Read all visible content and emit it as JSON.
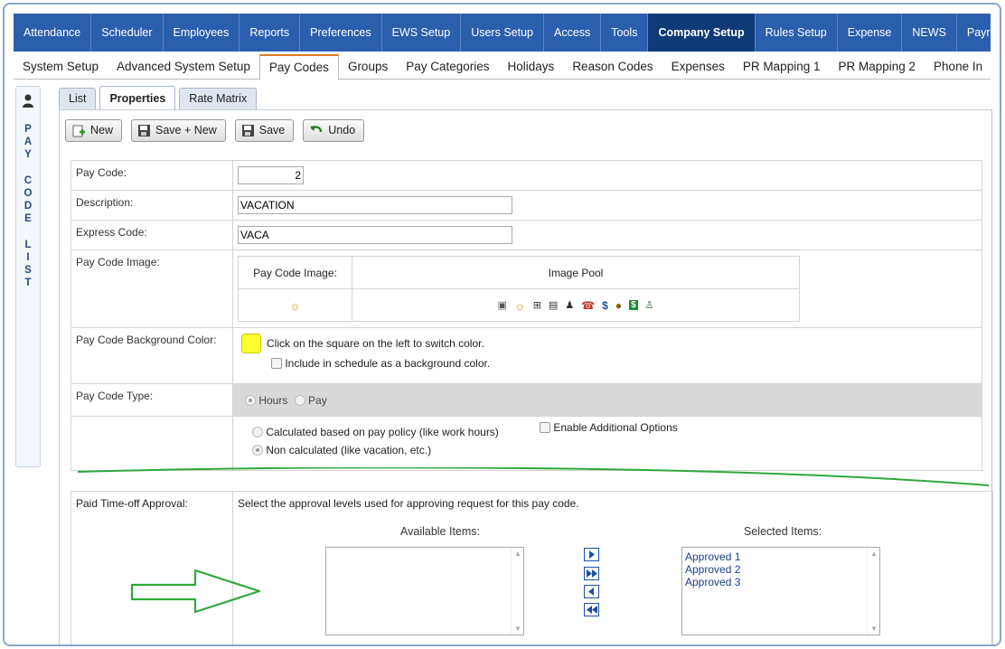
{
  "topnav": {
    "items": [
      "Attendance",
      "Scheduler",
      "Employees",
      "Reports",
      "Preferences",
      "EWS Setup",
      "Users Setup",
      "Access",
      "Tools",
      "Company Setup",
      "Rules Setup",
      "Expense",
      "NEWS",
      "Payroll"
    ],
    "active": "Company Setup"
  },
  "subnav": {
    "items": [
      "System Setup",
      "Advanced System Setup",
      "Pay Codes",
      "Groups",
      "Pay Categories",
      "Holidays",
      "Reason Codes",
      "Expenses",
      "PR Mapping 1",
      "PR Mapping 2",
      "Phone In"
    ],
    "active": "Pay Codes"
  },
  "side_panel": {
    "label": "PAY CODE LIST"
  },
  "tabs": [
    "List",
    "Properties",
    "Rate Matrix"
  ],
  "toolbar": {
    "new": "New",
    "save_new": "Save + New",
    "save": "Save",
    "undo": "Undo"
  },
  "form": {
    "pay_code": {
      "label": "Pay Code:",
      "value": "2"
    },
    "description": {
      "label": "Description:",
      "value": "VACATION"
    },
    "express_code": {
      "label": "Express Code:",
      "value": "VACA"
    },
    "pay_code_image": {
      "label": "Pay Code Image:",
      "col1_header": "Pay Code Image:",
      "col2_header": "Image Pool",
      "selected_icon": "sun-icon",
      "pool_icons": [
        "calendar-icon",
        "sun-icon",
        "medical-kit-icon",
        "calendar-one-icon",
        "person-icon",
        "phone-icon",
        "dollar-icon",
        "burger-icon",
        "money-icon",
        "user-icon"
      ]
    },
    "background_color": {
      "label": "Pay Code Background Color:",
      "color": "#ffff33",
      "hint": "Click on the square on the left to switch color.",
      "include_label": "Include in schedule as a background color."
    },
    "pay_code_type": {
      "label": "Pay Code Type:",
      "hours": "Hours",
      "pay": "Pay",
      "selected": "Hours"
    },
    "calc": {
      "calculated": "Calculated based on pay policy (like work hours)",
      "non_calculated": "Non calculated (like vacation, etc.)",
      "enable_additional": "Enable Additional Options",
      "selected": "non_calculated"
    }
  },
  "approval": {
    "label": "Paid Time-off Approval:",
    "instruction": "Select the approval levels used for approving request for this pay code.",
    "available_label": "Available Items:",
    "selected_label": "Selected Items:",
    "available_items": [],
    "selected_items": [
      "Approved 1",
      "Approved 2",
      "Approved 3"
    ]
  },
  "colors": {
    "nav_bg": "#2a5fae",
    "nav_active": "#0f3a78",
    "annotation": "#2fa83c"
  }
}
